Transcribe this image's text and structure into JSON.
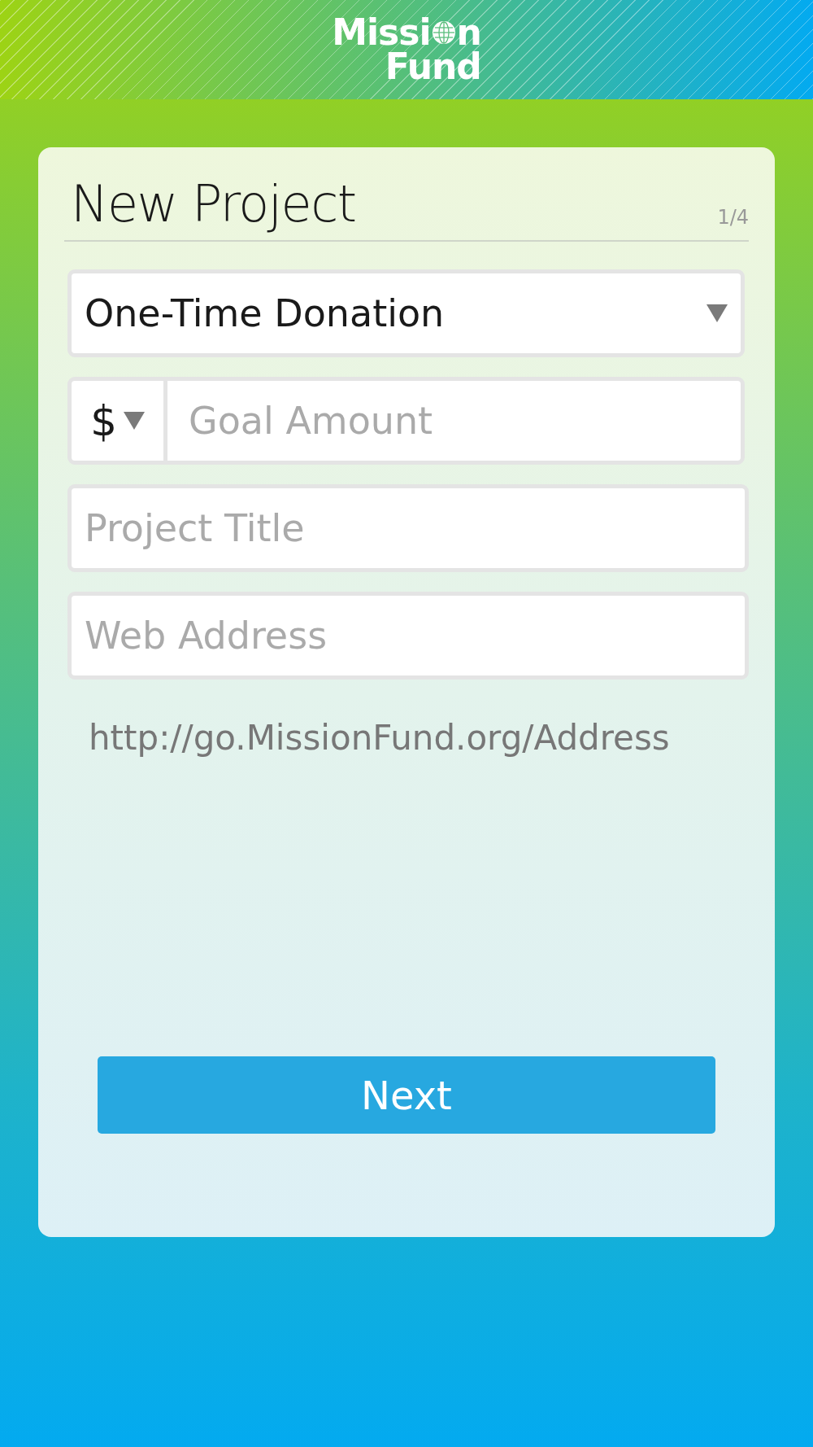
{
  "logo": {
    "before_globe": "Missi",
    "after_globe": "n",
    "second_line": "Fund"
  },
  "form": {
    "title": "New Project",
    "step": "1/4",
    "project_type": {
      "value": "One-Time Donation"
    },
    "currency": {
      "value": "$"
    },
    "goal_amount": {
      "placeholder": "Goal Amount"
    },
    "project_title": {
      "placeholder": "Project Title"
    },
    "web_address": {
      "placeholder": "Web Address"
    },
    "url_preview": "http://go.MissionFund.org/Address",
    "next_button": "Next"
  }
}
